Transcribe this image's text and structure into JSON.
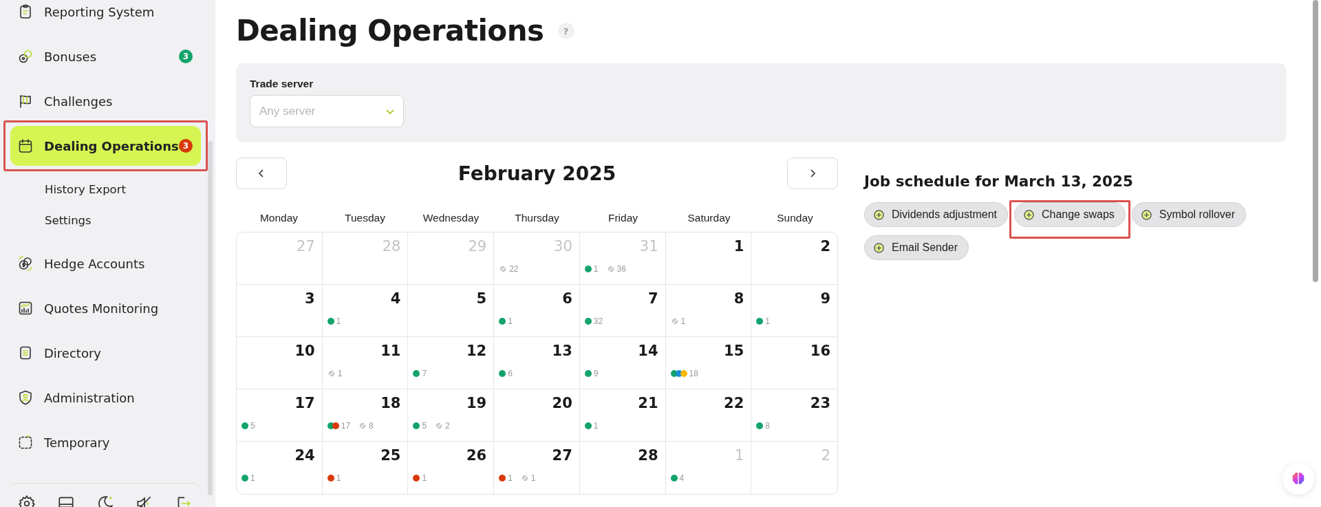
{
  "sidebar": {
    "items": [
      {
        "label": "Reporting System",
        "selected": false,
        "highlighted": false
      },
      {
        "label": "Bonuses",
        "selected": false,
        "highlighted": false,
        "badge": "3",
        "color": "#13a36b"
      },
      {
        "label": "Challenges",
        "selected": false,
        "highlighted": false
      },
      {
        "label": "Dealing Operations",
        "selected": true,
        "highlighted": true,
        "badge": "3",
        "color": "#d83a0a",
        "children": [
          {
            "label": "History Export"
          },
          {
            "label": "Settings"
          }
        ]
      },
      {
        "label": "Hedge Accounts",
        "selected": false,
        "highlighted": false
      },
      {
        "label": "Quotes Monitoring",
        "selected": false,
        "highlighted": false
      },
      {
        "label": "Directory",
        "selected": false,
        "highlighted": false
      },
      {
        "label": "Administration",
        "selected": false,
        "highlighted": false
      },
      {
        "label": "Temporary",
        "selected": false,
        "highlighted": false
      }
    ]
  },
  "page": {
    "title": "Dealing Operations",
    "help": "?"
  },
  "filter": {
    "label": "Trade server",
    "placeholder": "Any server"
  },
  "calendar": {
    "month": "February 2025",
    "weekdays": [
      "Monday",
      "Tuesday",
      "Wednesday",
      "Thursday",
      "Friday",
      "Saturday",
      "Sunday"
    ],
    "weeks": [
      [
        {
          "day": "27",
          "muted": true
        },
        {
          "day": "28",
          "muted": true
        },
        {
          "day": "29",
          "muted": true
        },
        {
          "day": "30",
          "muted": true,
          "marks": [
            {
              "kind": "skipped",
              "count": "22"
            }
          ]
        },
        {
          "day": "31",
          "muted": true,
          "marks": [
            {
              "kind": "dots",
              "dots": [
                {
                  "color": "#13a36b"
                }
              ],
              "count": "1"
            },
            {
              "kind": "skipped",
              "count": "36"
            }
          ]
        },
        {
          "day": "1",
          "muted": false
        },
        {
          "day": "2",
          "muted": false
        }
      ],
      [
        {
          "day": "3",
          "muted": false
        },
        {
          "day": "4",
          "muted": false,
          "marks": [
            {
              "kind": "dots",
              "dots": [
                {
                  "color": "#13a36b"
                }
              ],
              "count": "1"
            }
          ]
        },
        {
          "day": "5",
          "muted": false
        },
        {
          "day": "6",
          "muted": false,
          "marks": [
            {
              "kind": "dots",
              "dots": [
                {
                  "color": "#13a36b"
                }
              ],
              "count": "1"
            }
          ]
        },
        {
          "day": "7",
          "muted": false,
          "marks": [
            {
              "kind": "dots",
              "dots": [
                {
                  "color": "#13a36b"
                }
              ],
              "count": "32"
            }
          ]
        },
        {
          "day": "8",
          "muted": false,
          "marks": [
            {
              "kind": "skipped",
              "count": "1"
            }
          ]
        },
        {
          "day": "9",
          "muted": false,
          "marks": [
            {
              "kind": "dots",
              "dots": [
                {
                  "color": "#13a36b"
                }
              ],
              "count": "1"
            }
          ]
        }
      ],
      [
        {
          "day": "10",
          "muted": false
        },
        {
          "day": "11",
          "muted": false,
          "marks": [
            {
              "kind": "skipped",
              "count": "1"
            }
          ]
        },
        {
          "day": "12",
          "muted": false,
          "marks": [
            {
              "kind": "dots",
              "dots": [
                {
                  "color": "#13a36b"
                }
              ],
              "count": "7"
            }
          ]
        },
        {
          "day": "13",
          "muted": false,
          "marks": [
            {
              "kind": "dots",
              "dots": [
                {
                  "color": "#13a36b"
                }
              ],
              "count": "6"
            }
          ]
        },
        {
          "day": "14",
          "muted": false,
          "marks": [
            {
              "kind": "dots",
              "dots": [
                {
                  "color": "#13a36b"
                }
              ],
              "count": "9"
            }
          ]
        },
        {
          "day": "15",
          "muted": false,
          "marks": [
            {
              "kind": "dots",
              "dots": [
                {
                  "color": "#13a36b"
                },
                {
                  "color": "#1a8ad8"
                },
                {
                  "color": "#f5b800"
                }
              ],
              "count": "18"
            }
          ]
        },
        {
          "day": "16",
          "muted": false
        }
      ],
      [
        {
          "day": "17",
          "muted": false,
          "marks": [
            {
              "kind": "dots",
              "dots": [
                {
                  "color": "#13a36b"
                }
              ],
              "count": "5"
            }
          ]
        },
        {
          "day": "18",
          "muted": false,
          "marks": [
            {
              "kind": "dots",
              "dots": [
                {
                  "color": "#13a36b"
                },
                {
                  "color": "#d83a0a"
                }
              ],
              "count": "17"
            },
            {
              "kind": "skipped",
              "count": "8"
            }
          ]
        },
        {
          "day": "19",
          "muted": false,
          "marks": [
            {
              "kind": "dots",
              "dots": [
                {
                  "color": "#13a36b"
                }
              ],
              "count": "5"
            },
            {
              "kind": "skipped",
              "count": "2"
            }
          ]
        },
        {
          "day": "20",
          "muted": false
        },
        {
          "day": "21",
          "muted": false,
          "marks": [
            {
              "kind": "dots",
              "dots": [
                {
                  "color": "#13a36b"
                }
              ],
              "count": "1"
            }
          ]
        },
        {
          "day": "22",
          "muted": false
        },
        {
          "day": "23",
          "muted": false,
          "marks": [
            {
              "kind": "dots",
              "dots": [
                {
                  "color": "#13a36b"
                }
              ],
              "count": "8"
            }
          ]
        }
      ],
      [
        {
          "day": "24",
          "muted": false,
          "marks": [
            {
              "kind": "dots",
              "dots": [
                {
                  "color": "#13a36b"
                }
              ],
              "count": "1"
            }
          ]
        },
        {
          "day": "25",
          "muted": false,
          "marks": [
            {
              "kind": "dots",
              "dots": [
                {
                  "color": "#d83a0a"
                }
              ],
              "count": "1"
            }
          ]
        },
        {
          "day": "26",
          "muted": false,
          "marks": [
            {
              "kind": "dots",
              "dots": [
                {
                  "color": "#d83a0a"
                }
              ],
              "count": "1"
            }
          ]
        },
        {
          "day": "27",
          "muted": false,
          "marks": [
            {
              "kind": "dots",
              "dots": [
                {
                  "color": "#d83a0a"
                }
              ],
              "count": "1"
            },
            {
              "kind": "skipped",
              "count": "1"
            }
          ]
        },
        {
          "day": "28",
          "muted": false
        },
        {
          "day": "1",
          "muted": true,
          "marks": [
            {
              "kind": "dots",
              "dots": [
                {
                  "color": "#13a36b"
                }
              ],
              "count": "4"
            }
          ]
        },
        {
          "day": "2",
          "muted": true
        }
      ]
    ]
  },
  "jobs": {
    "title": "Job schedule for March 13, 2025",
    "items": [
      {
        "label": "Dividends adjustment",
        "highlighted": false
      },
      {
        "label": "Change swaps",
        "highlighted": true
      },
      {
        "label": "Symbol rollover",
        "highlighted": false
      },
      {
        "label": "Email Sender",
        "highlighted": false
      }
    ]
  }
}
